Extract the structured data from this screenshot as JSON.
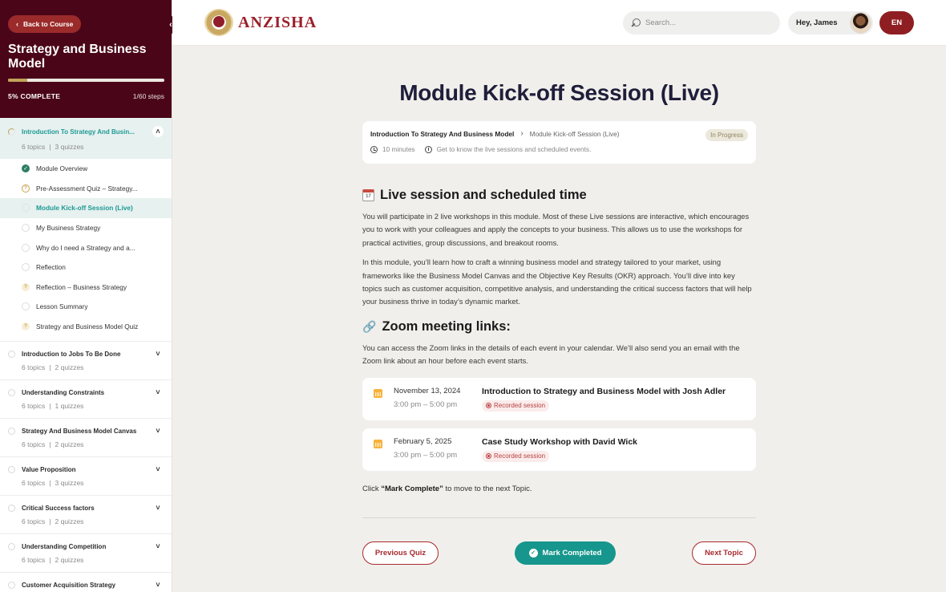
{
  "sidebar": {
    "back_label": "Back to Course",
    "course_title": "Strategy and Business Model",
    "progress_percent": 5,
    "progress_label": "5% COMPLETE",
    "steps_label": "1/60 steps",
    "sections": [
      {
        "title": "Introduction To Strategy And Busin...",
        "topics": "6 topics",
        "quizzes": "3 quizzes",
        "expanded": true,
        "lessons": [
          {
            "label": "Module Overview",
            "status": "done"
          },
          {
            "label": "Pre-Assessment Quiz – Strategy...",
            "status": "quiz"
          },
          {
            "label": "Module Kick-off Session (Live)",
            "status": "current"
          },
          {
            "label": "My Business Strategy",
            "status": "empty"
          },
          {
            "label": "Why do I need a Strategy and a...",
            "status": "empty"
          },
          {
            "label": "Reflection",
            "status": "empty"
          },
          {
            "label": "Reflection – Business Strategy",
            "status": "quiz-light"
          },
          {
            "label": "Lesson Summary",
            "status": "empty"
          },
          {
            "label": "Strategy and Business Model Quiz",
            "status": "quiz-light"
          }
        ]
      },
      {
        "title": "Introduction to Jobs To Be Done",
        "topics": "6 topics",
        "quizzes": "2 quizzes"
      },
      {
        "title": "Understanding Constraints",
        "topics": "6 topics",
        "quizzes": "1 quizzes"
      },
      {
        "title": "Strategy And Business Model Canvas",
        "topics": "6 topics",
        "quizzes": "2 quizzes"
      },
      {
        "title": "Value Proposition",
        "topics": "6 topics",
        "quizzes": "3 quizzes"
      },
      {
        "title": "Critical Success factors",
        "topics": "6 topics",
        "quizzes": "2 quizzes"
      },
      {
        "title": "Understanding Competition",
        "topics": "6 topics",
        "quizzes": "2 quizzes"
      },
      {
        "title": "Customer Acquisition Strategy",
        "topics": "",
        "quizzes": ""
      }
    ]
  },
  "header": {
    "brand": "ANZISHA",
    "search_placeholder": "Search...",
    "greeting": "Hey, James",
    "language": "EN"
  },
  "main": {
    "title": "Module Kick-off Session (Live)",
    "breadcrumb": {
      "parent": "Introduction To Strategy And Business Model",
      "current": "Module Kick-off Session (Live)"
    },
    "status": "In Progress",
    "duration": "10 minutes",
    "description": "Get to know the live sessions and scheduled events.",
    "section1": {
      "heading": "Live session and scheduled time",
      "paragraphs": [
        "You will participate in 2 live workshops in this module. Most of these Live sessions are interactive, which encourages you to work with your colleagues and apply the concepts to your business. This allows us to use the workshops for practical activities, group discussions, and breakout rooms.",
        "In this module, you’ll learn how to craft a winning business model and strategy tailored to your market, using frameworks like the Business Model Canvas and the Objective Key Results (OKR) approach. You’ll dive into key topics such as customer acquisition, competitive analysis, and understanding the critical success factors that will help your business thrive in today’s dynamic market."
      ]
    },
    "section2": {
      "heading": "Zoom meeting links:",
      "paragraph": "You can access the Zoom links in the details of each event in your calendar. We’ll also send you an email with the Zoom link about an hour before each event starts."
    },
    "events": [
      {
        "date": "November 13, 2024",
        "time": "3:00 pm – 5:00 pm",
        "title": "Introduction to Strategy and Business Model with Josh Adler",
        "badge": "Recorded session"
      },
      {
        "date": "February 5, 2025",
        "time": "3:00 pm – 5:00 pm",
        "title": "Case Study Workshop with David Wick",
        "badge": "Recorded session"
      }
    ],
    "note_prefix": "Click ",
    "note_bold": "“Mark Complete”",
    "note_suffix": " to move to the next Topic.",
    "buttons": {
      "previous": "Previous Quiz",
      "complete": "Mark Completed",
      "next": "Next Topic"
    }
  },
  "colors": {
    "brand_maroon": "#4a0618",
    "accent_red": "#8f1e22",
    "teal": "#16968c",
    "gold": "#c1a35a"
  }
}
